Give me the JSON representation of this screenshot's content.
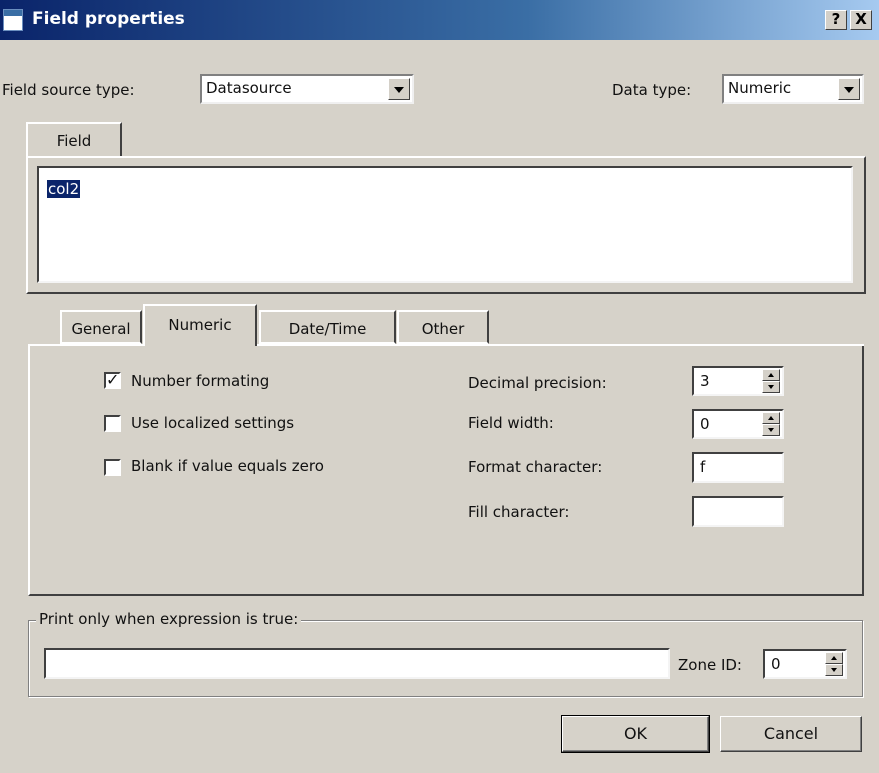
{
  "window": {
    "title": "Field properties",
    "help_btn": "?",
    "close_btn": "X"
  },
  "source": {
    "label": "Field source type:",
    "value": "Datasource"
  },
  "datatype": {
    "label": "Data type:",
    "value": "Numeric"
  },
  "field_tab": {
    "label": "Field",
    "value": "col2"
  },
  "tabs": [
    {
      "label": "General"
    },
    {
      "label": "Numeric"
    },
    {
      "label": "Date/Time"
    },
    {
      "label": "Other"
    }
  ],
  "numeric": {
    "checks": [
      {
        "label": "Number formating",
        "checked": true,
        "mark": "✓"
      },
      {
        "label": "Use localized settings",
        "checked": false
      },
      {
        "label": "Blank if value equals zero",
        "checked": false
      }
    ],
    "decimal_precision": {
      "label": "Decimal precision:",
      "value": "3"
    },
    "field_width": {
      "label": "Field width:",
      "value": "0"
    },
    "format_char": {
      "label": "Format character:",
      "value": "f"
    },
    "fill_char": {
      "label": "Fill character:",
      "value": ""
    }
  },
  "print_group": {
    "legend": "Print only when expression is true:",
    "expression": ""
  },
  "zone": {
    "label": "Zone ID:",
    "value": "0"
  },
  "buttons": {
    "ok": "OK",
    "cancel": "Cancel"
  },
  "colors": {
    "title_start": "#0a246a",
    "title_end": "#a6caf0",
    "selection": "#0a246a",
    "face": "#d6d2c9"
  }
}
